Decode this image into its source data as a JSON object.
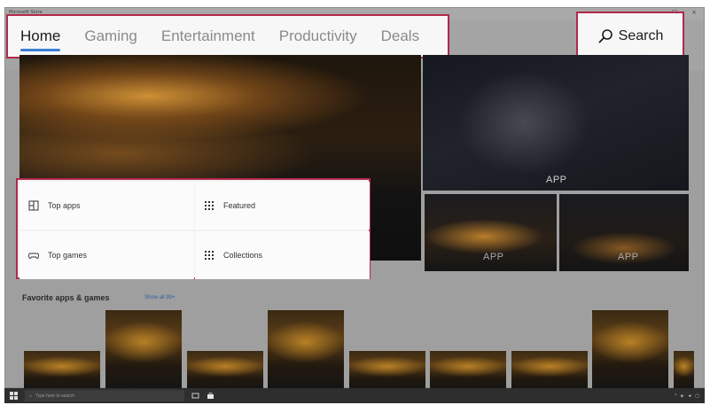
{
  "window": {
    "title": "Microsoft Store"
  },
  "nav": {
    "tabs": [
      {
        "label": "Home",
        "active": true
      },
      {
        "label": "Gaming",
        "active": false
      },
      {
        "label": "Entertainment",
        "active": false
      },
      {
        "label": "Productivity",
        "active": false
      },
      {
        "label": "Deals",
        "active": false
      }
    ],
    "search_label": "Search"
  },
  "tiles": {
    "big_label": "APP",
    "small1_label": "APP",
    "small2_label": "APP"
  },
  "quick_links": [
    {
      "label": "Top apps",
      "icon": "top-apps-icon"
    },
    {
      "label": "Featured",
      "icon": "grid-icon"
    },
    {
      "label": "Top games",
      "icon": "gamepad-icon"
    },
    {
      "label": "Collections",
      "icon": "grid-icon"
    }
  ],
  "favorites": {
    "title": "Favorite apps & games",
    "link": "Show all 99+"
  },
  "taskbar": {
    "search_placeholder": "Type here to search"
  },
  "colors": {
    "highlight": "#b0294c",
    "accent": "#3a7fd6"
  }
}
